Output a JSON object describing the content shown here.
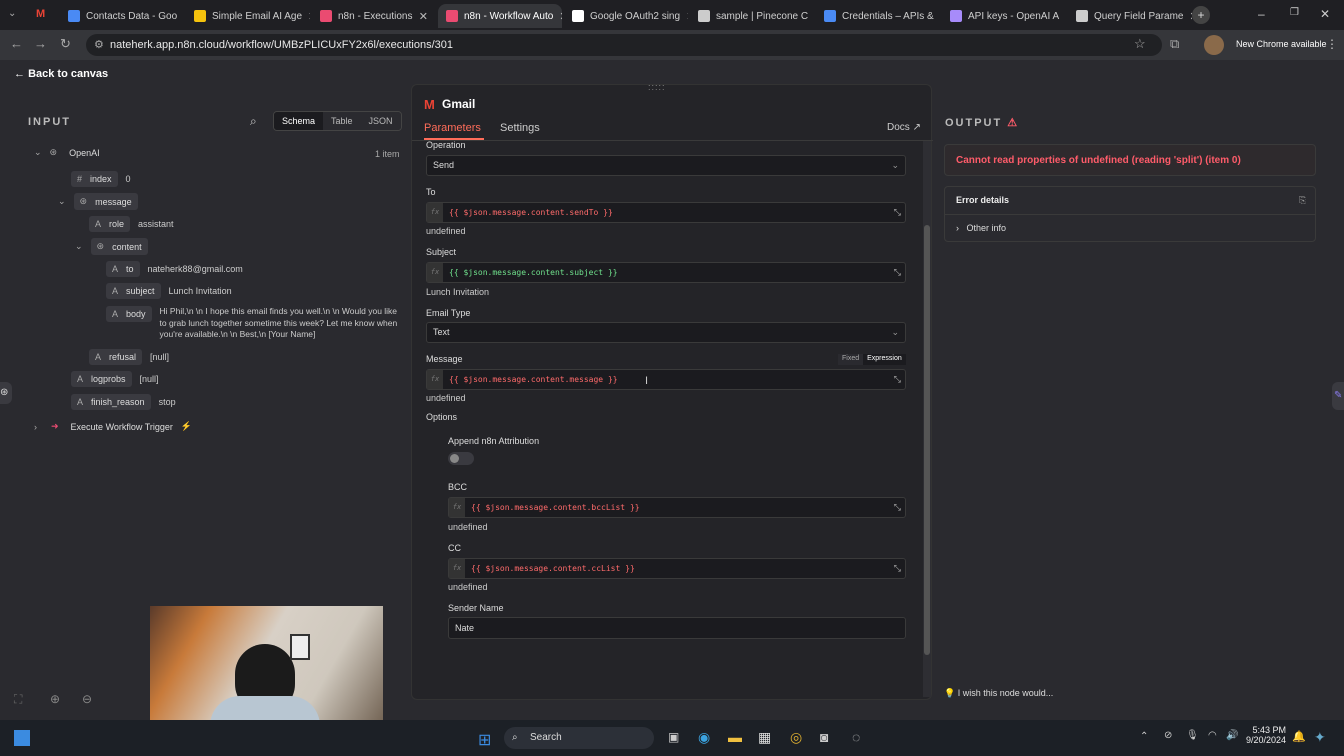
{
  "browser": {
    "tabs": [
      {
        "label": "Contacts Data - Goo",
        "color": "#4a8af4"
      },
      {
        "label": "Simple Email AI Age",
        "color": "#f4c20d"
      },
      {
        "label": "n8n - Executions",
        "color": "#ea4b71"
      },
      {
        "label": "n8n - Workflow Auto",
        "color": "#ea4b71"
      },
      {
        "label": "Google OAuth2 sing",
        "color": "#ffffff"
      },
      {
        "label": "sample | Pinecone C",
        "color": "#cccccc"
      },
      {
        "label": "Credentials – APIs &",
        "color": "#4a8af4"
      },
      {
        "label": "API keys - OpenAI A",
        "color": "#a78bfa"
      },
      {
        "label": "Query Field Parame",
        "color": "#cccccc"
      }
    ],
    "url": "nateherk.app.n8n.cloud/workflow/UMBzPLICUxFY2x6l/executions/301",
    "update_label": "New Chrome available"
  },
  "back_label": "Back to canvas",
  "input": {
    "title": "INPUT",
    "views": [
      "Schema",
      "Table",
      "JSON"
    ],
    "node_name": "OpenAI",
    "item_count": "1 item",
    "fields": {
      "index_key": "index",
      "index_val": "0",
      "message_key": "message",
      "role_key": "role",
      "role_val": "assistant",
      "content_key": "content",
      "to_key": "to",
      "to_val": "nateherk88@gmail.com",
      "subject_key": "subject",
      "subject_val": "Lunch Invitation",
      "body_key": "body",
      "body_val": "Hi Phil,\\n \\n I hope this email finds you well.\\n \\n Would you like to grab lunch together sometime this week? Let me know when you're available.\\n \\n Best,\\n [Your Name]",
      "refusal_key": "refusal",
      "refusal_val": "[null]",
      "logprobs_key": "logprobs",
      "logprobs_val": "[null]",
      "finish_key": "finish_reason",
      "finish_val": "stop"
    },
    "trigger_name": "Execute Workflow Trigger"
  },
  "node": {
    "title": "Gmail",
    "tabs": [
      "Parameters",
      "Settings"
    ],
    "docs": "Docs",
    "operation_label": "Operation",
    "operation_value": "Send",
    "to_label": "To",
    "to_expr": "{{ $json.message.content.sendTo }}",
    "to_result": "undefined",
    "subject_label": "Subject",
    "subject_expr": "{{ $json.message.content.subject }}",
    "subject_result": "Lunch Invitation",
    "emailtype_label": "Email Type",
    "emailtype_value": "Text",
    "message_label": "Message",
    "mode_fixed": "Fixed",
    "mode_expression": "Expression",
    "message_expr": "{{ $json.message.content.message }}",
    "message_result": "undefined",
    "options_label": "Options",
    "attribution_label": "Append n8n Attribution",
    "bcc_label": "BCC",
    "bcc_expr": "{{ $json.message.content.bccList }}",
    "bcc_result": "undefined",
    "cc_label": "CC",
    "cc_expr": "{{ $json.message.content.ccList }}",
    "cc_result": "undefined",
    "sender_label": "Sender Name",
    "sender_value": "Nate"
  },
  "output": {
    "title": "OUTPUT",
    "error": "Cannot read properties of undefined (reading 'split') (item 0)",
    "details_label": "Error details",
    "other_info": "Other info",
    "wish": "I wish this node would..."
  },
  "taskbar": {
    "search": "Search",
    "time": "5:43 PM",
    "date": "9/20/2024"
  }
}
